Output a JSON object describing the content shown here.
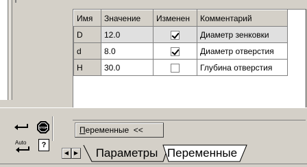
{
  "variables_table": {
    "headers": {
      "name": "Имя",
      "value": "Значение",
      "changed": "Изменен",
      "comment": "Комментарий"
    },
    "rows": [
      {
        "name": "D",
        "value": "12.0",
        "changed": true,
        "comment": "Диаметр зенковки"
      },
      {
        "name": "d",
        "value": "8.0",
        "changed": true,
        "comment": "Диаметр отверстия"
      },
      {
        "name": "H",
        "value": "30.0",
        "changed": false,
        "comment": "Глубина отверстия"
      }
    ]
  },
  "variables_toggle": {
    "label_underlined": "П",
    "label_rest": "еременные  <<"
  },
  "toolbar_icons": {
    "enter_icon": "enter-arrow-icon",
    "stop_icon": "stop-icon",
    "auto_label": "Auto",
    "help_icon": "help-icon",
    "help_glyph": "?"
  },
  "tabs": [
    {
      "label": "Параметры",
      "active": false
    },
    {
      "label": "Переменные",
      "active": true
    }
  ]
}
